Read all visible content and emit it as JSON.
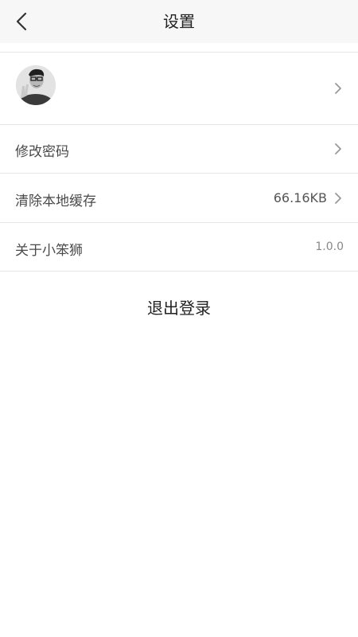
{
  "header": {
    "title": "设置",
    "back_icon": "chevron-left-icon"
  },
  "profile": {
    "avatar_icon": "user-avatar",
    "chevron_icon": "chevron-right-icon"
  },
  "settings": {
    "change_password": {
      "label": "修改密码"
    },
    "clear_cache": {
      "label": "清除本地缓存",
      "value": "66.16KB"
    },
    "about": {
      "label": "关于小笨狮",
      "value": "1.0.0"
    }
  },
  "logout": {
    "label": "退出登录"
  },
  "colors": {
    "header_bg": "#f7f7f7",
    "divider": "#e6e6e6",
    "chevron": "#999999"
  }
}
